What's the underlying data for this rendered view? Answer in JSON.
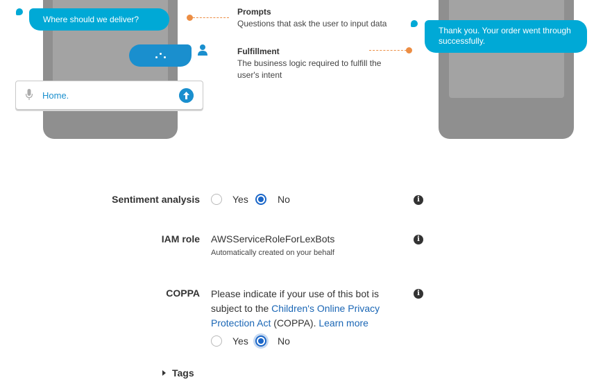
{
  "illustration": {
    "prompt_bubble": "Where should we deliver?",
    "input_value": "Home.",
    "confirmation_bubble": "Thank you. Your order went through successfully.",
    "callouts": [
      {
        "title": "Prompts",
        "description": "Questions that ask the user to input data"
      },
      {
        "title": "Fulfillment",
        "description": "The business logic required to fulfill the user's intent"
      }
    ],
    "accent_color": "#00a9d6",
    "callout_color": "#ec8d43"
  },
  "form": {
    "sentiment": {
      "label": "Sentiment analysis",
      "options": [
        "Yes",
        "No"
      ],
      "selected": "No"
    },
    "iam_role": {
      "label": "IAM role",
      "value": "AWSServiceRoleForLexBots",
      "note": "Automatically created on your behalf"
    },
    "coppa": {
      "label": "COPPA",
      "text_before": "Please indicate if your use of this bot is subject to the ",
      "link_act": "Children's Online Privacy Protection Act",
      "text_middle": " (COPPA). ",
      "link_learn": "Learn more",
      "options": [
        "Yes",
        "No"
      ],
      "selected": "No"
    },
    "tags": {
      "label": "Tags"
    },
    "radio_color": "#1a66c8"
  }
}
